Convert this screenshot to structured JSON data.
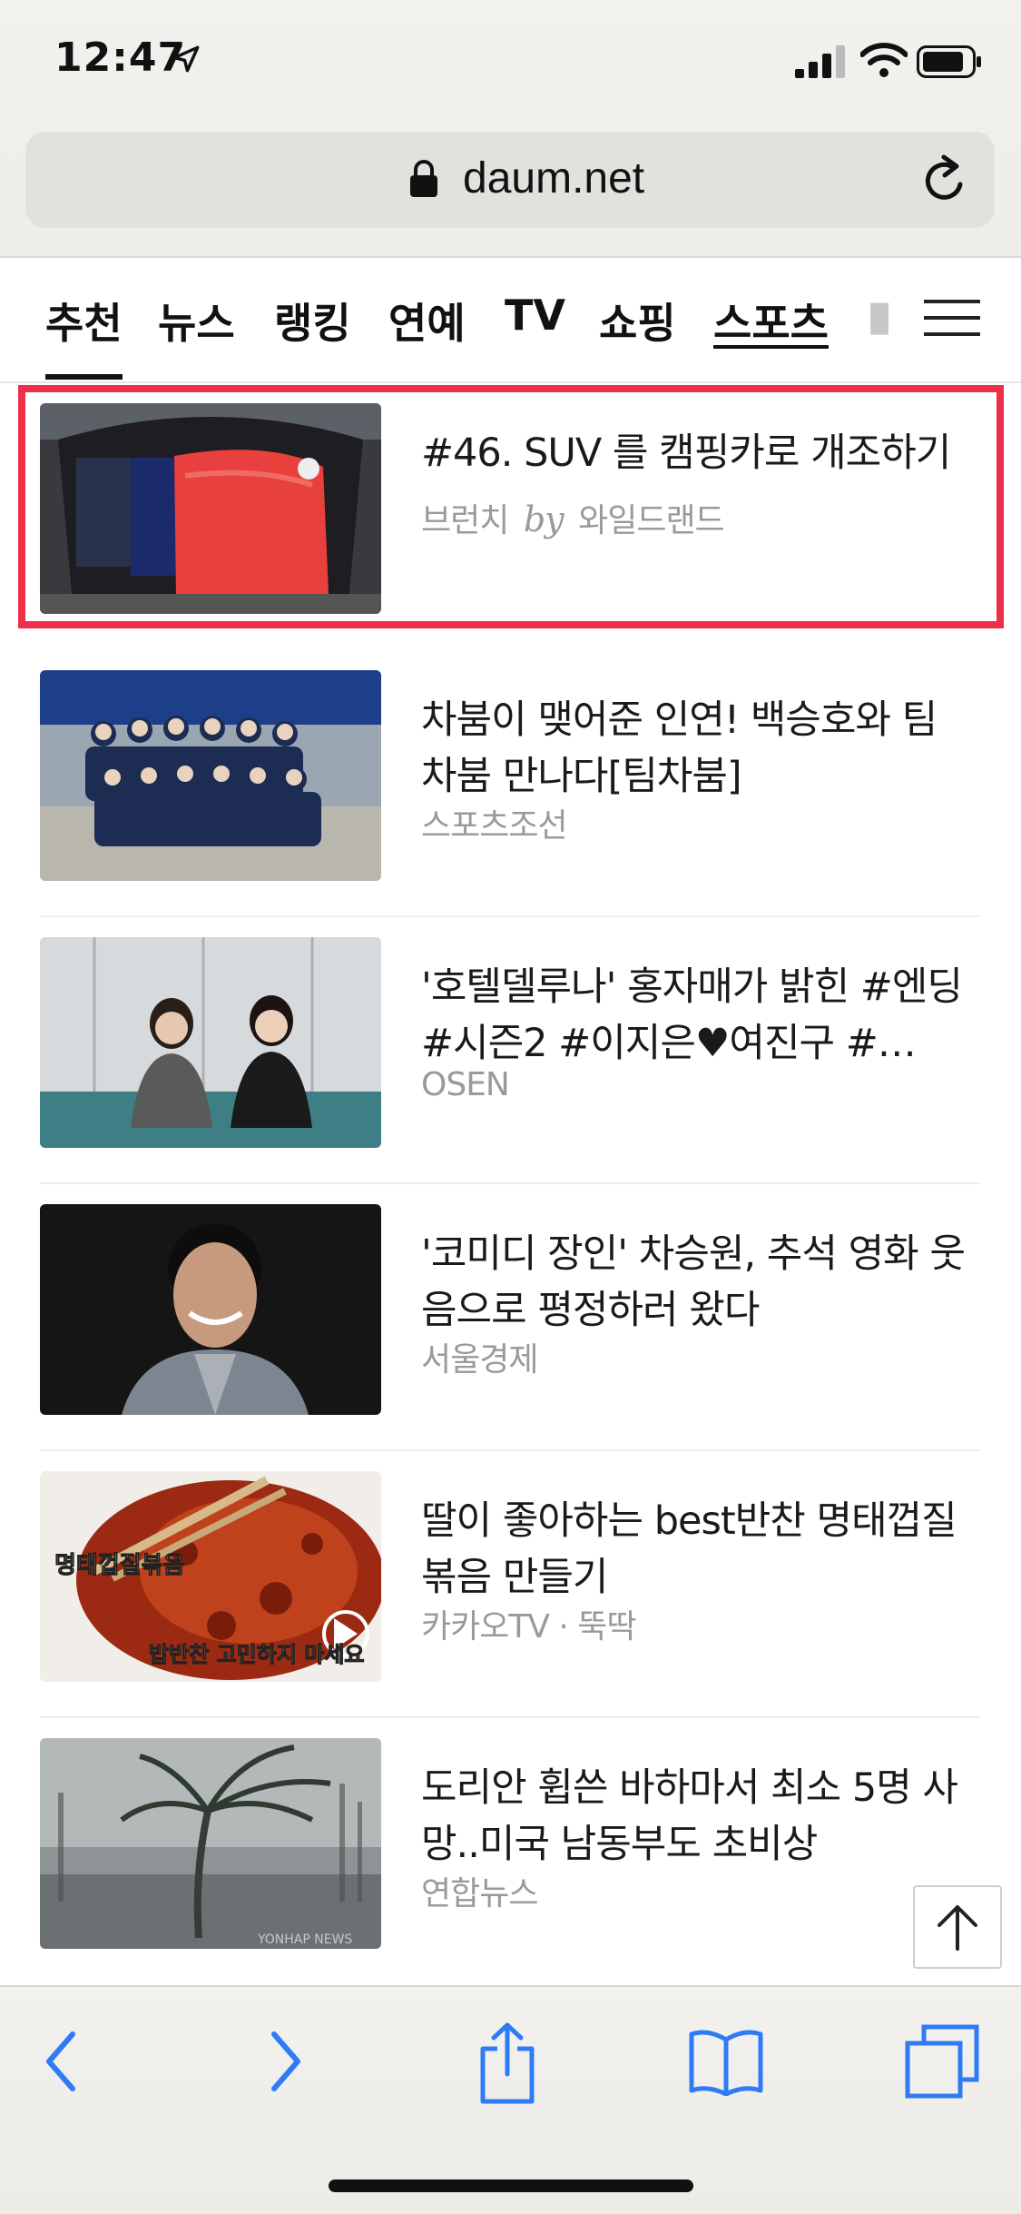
{
  "status_bar": {
    "time": "12:47"
  },
  "browser": {
    "url": "daum.net"
  },
  "tabs": [
    {
      "label": "추천"
    },
    {
      "label": "뉴스"
    },
    {
      "label": "랭킹"
    },
    {
      "label": "연예"
    },
    {
      "label": "TV"
    },
    {
      "label": "쇼핑"
    },
    {
      "label": "스포츠"
    }
  ],
  "feed": [
    {
      "title": "#46. SUV 를 캠핑카로 개조하기",
      "source": "브런치",
      "by": "by",
      "author": "와일드랜드"
    },
    {
      "title": "차붐이 맺어준 인연! 백승호와 팀 차붐 만나다[팀차붐]",
      "source": "스포츠조선"
    },
    {
      "title": "'호텔델루나' 홍자매가 밝힌 #엔딩 #시즌2 #이지은♥여진구 #…",
      "source": "OSEN"
    },
    {
      "title": "'코미디 장인' 차승원, 추석 영화 웃음으로 평정하러 왔다",
      "source": "서울경제"
    },
    {
      "title": "딸이 좋아하는 best반찬 명태껍질볶음 만들기",
      "source": "카카오TV · 뚝딱",
      "thumb_caption_1": "명태껍질볶음",
      "thumb_caption_2": "밥반찬 고민하지 마세요"
    },
    {
      "title": "도리안 휩쓴 바하마서 최소 5명 사망..미국 남동부도 초비상",
      "source": "연합뉴스",
      "watermark": "YONHAP NEWS"
    }
  ],
  "colors": {
    "highlight": "#ee2f4a",
    "ios_blue": "#2f7bf5"
  }
}
